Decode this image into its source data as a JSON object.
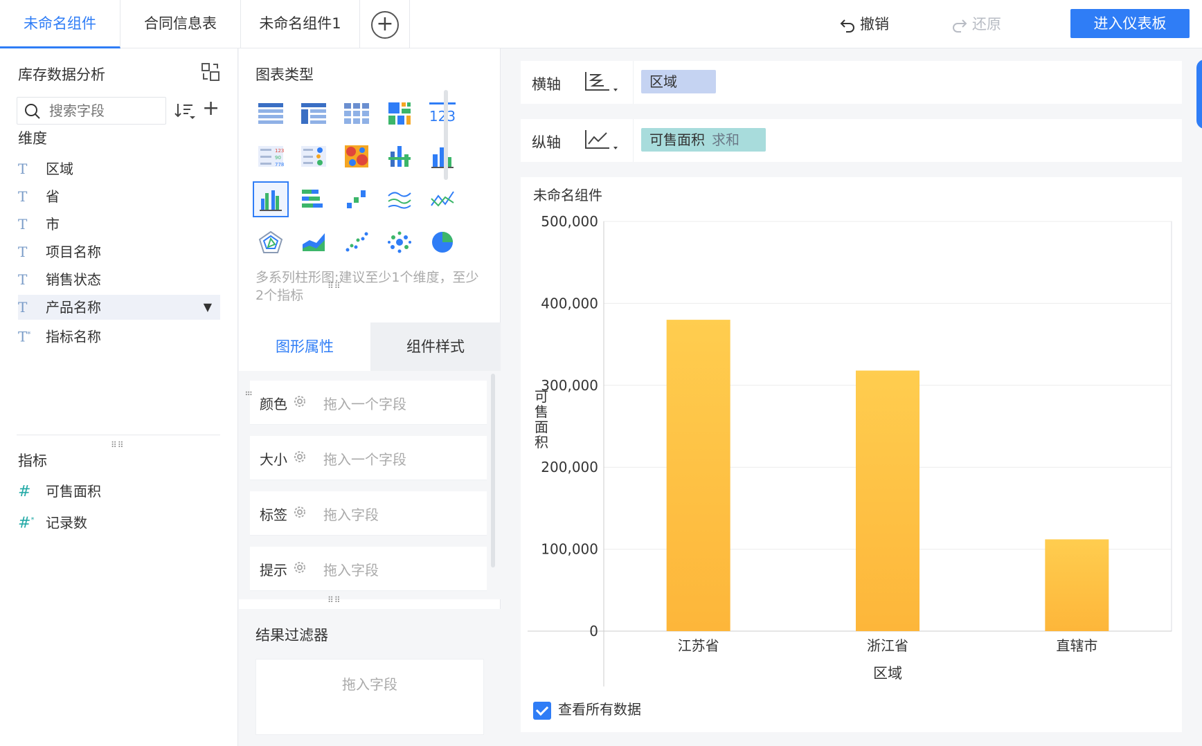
{
  "tabs": [
    {
      "label": "未命名组件",
      "active": true
    },
    {
      "label": "合同信息表",
      "active": false
    },
    {
      "label": "未命名组件1",
      "active": false
    }
  ],
  "toolbar": {
    "undo_label": "撤销",
    "redo_label": "还原",
    "enter_dashboard_label": "进入仪表板"
  },
  "left": {
    "dataset_title": "库存数据分析",
    "search_placeholder": "搜索字段",
    "dimension_heading": "维度",
    "dimensions": [
      "区域",
      "省",
      "市",
      "项目名称",
      "销售状态",
      "产品名称",
      "指标名称"
    ],
    "measure_heading": "指标",
    "measures": [
      "可售面积",
      "记录数"
    ]
  },
  "middle": {
    "chart_type_heading": "图表类型",
    "chart_type_hint": "多系列柱形图:建议至少1个维度，至少2个指标",
    "property_tabs": [
      "图形属性",
      "组件样式"
    ],
    "properties": [
      {
        "label": "颜色",
        "placeholder": "拖入一个字段"
      },
      {
        "label": "大小",
        "placeholder": "拖入一个字段"
      },
      {
        "label": "标签",
        "placeholder": "拖入字段"
      },
      {
        "label": "提示",
        "placeholder": "拖入字段"
      }
    ],
    "filter_heading": "结果过滤器",
    "filter_placeholder": "拖入字段"
  },
  "right": {
    "x_axis_label": "横轴",
    "x_axis_field": "区域",
    "y_axis_label": "纵轴",
    "y_axis_field": "可售面积",
    "y_axis_agg": "求和",
    "chart_title": "未命名组件",
    "view_all_label": "查看所有数据",
    "view_all_checked": true
  },
  "colors": {
    "accent": "#2f7df6",
    "bar_top": "#ffcd4f",
    "bar_bottom": "#fdb63a"
  },
  "chart_data": {
    "type": "bar",
    "title": "未命名组件",
    "xlabel": "区域",
    "ylabel": "可售面积",
    "categories": [
      "江苏省",
      "浙江省",
      "直辖市"
    ],
    "values": [
      380000,
      318000,
      112000
    ],
    "ylim": [
      0,
      500000
    ],
    "yticks": [
      0,
      100000,
      200000,
      300000,
      400000,
      500000
    ],
    "ytick_labels": [
      "0",
      "100,000",
      "200,000",
      "300,000",
      "400,000",
      "500,000"
    ],
    "grid": true,
    "legend": "none"
  }
}
